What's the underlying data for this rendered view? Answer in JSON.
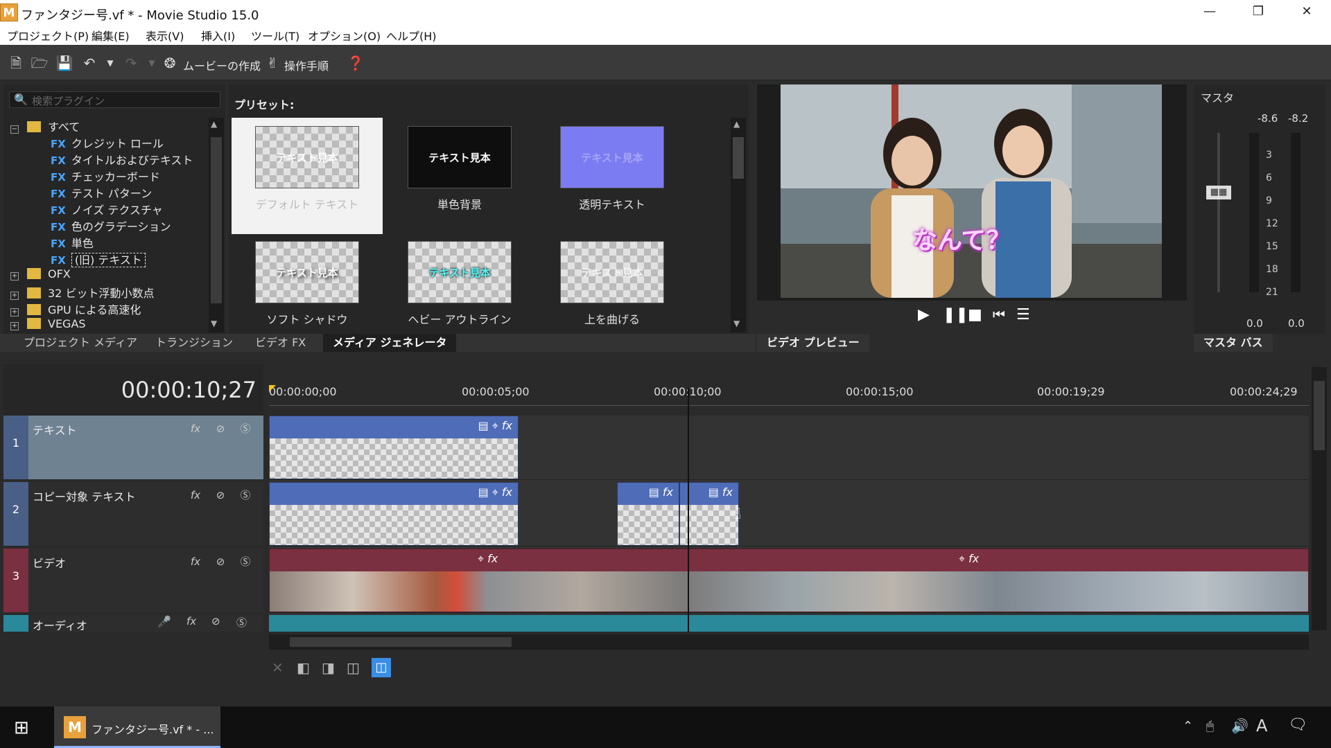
{
  "window": {
    "app_icon": "M",
    "title": "ファンタジー号.vf * - Movie Studio 15.0",
    "controls": [
      "—",
      "❐",
      "✕"
    ]
  },
  "menu": [
    "プロジェクト(P)",
    "編集(E)",
    "表示(V)",
    "挿入(I)",
    "ツール(T)",
    "オプション(O)",
    "ヘルプ(H)"
  ],
  "toolbar": {
    "make_movie": "ムービーの作成",
    "steps": "操作手順"
  },
  "plugins": {
    "search_placeholder": "検索プラグイン",
    "tree": [
      {
        "type": "folder",
        "label": "すべて",
        "expander": "−"
      },
      {
        "type": "fx",
        "label": "クレジット ロール"
      },
      {
        "type": "fx",
        "label": "タイトルおよびテキスト"
      },
      {
        "type": "fx",
        "label": "チェッカーボード"
      },
      {
        "type": "fx",
        "label": "テスト パターン"
      },
      {
        "type": "fx",
        "label": "ノイズ テクスチャ"
      },
      {
        "type": "fx",
        "label": "色のグラデーション"
      },
      {
        "type": "fx",
        "label": "単色"
      },
      {
        "type": "fx",
        "label": "(旧) テキスト",
        "selected": true
      },
      {
        "type": "folder",
        "label": "OFX",
        "expander": "+"
      },
      {
        "type": "folder",
        "label": "32 ビット浮動小数点",
        "expander": "+"
      },
      {
        "type": "folder",
        "label": "GPU による高速化",
        "expander": "+"
      },
      {
        "type": "folder",
        "label": "VEGAS",
        "expander": "+"
      }
    ],
    "fx_tag": "FX"
  },
  "presets": {
    "header": "プリセット:",
    "thumb_text": "テキスト見本",
    "items": [
      {
        "label": "デフォルト テキスト",
        "style": "default"
      },
      {
        "label": "単色背景",
        "style": "solid"
      },
      {
        "label": "透明テキスト",
        "style": "transparent"
      },
      {
        "label": "ソフト シャドウ",
        "style": "shadow"
      },
      {
        "label": "ヘビー アウトライン",
        "style": "outline"
      },
      {
        "label": "上を曲げる",
        "style": "bend"
      }
    ]
  },
  "tabs": [
    "プロジェクト メディア",
    "トランジション",
    "ビデオ FX",
    "メディア ジェネレータ"
  ],
  "preview": {
    "overlay_text": "なんて？",
    "tab": "ビデオ プレビュー"
  },
  "master": {
    "title": "マスタ",
    "peak_left": "-8.6",
    "peak_right": "-8.2",
    "scale": [
      "3",
      "6",
      "9",
      "12",
      "15",
      "18",
      "21"
    ],
    "bottom_left": "0.0",
    "bottom_right": "0.0",
    "tab": "マスタ バス"
  },
  "timeline": {
    "timecode": "00:00:10;27",
    "ruler": [
      "00:00:00;00",
      "00:00:05;00",
      "00:00:10;00",
      "00:00:15;00",
      "00:00:19;29",
      "00:00:24;29"
    ],
    "tracks": [
      {
        "num": "1",
        "name": "テキスト"
      },
      {
        "num": "2",
        "name": "コピー対象 テキスト"
      },
      {
        "num": "3",
        "name": "ビデオ"
      },
      {
        "num": "",
        "name": "オーディオ"
      }
    ]
  },
  "taskbar": {
    "app_label": "ファンタジー号.vf * - ...",
    "ime": "A"
  },
  "colors": {
    "text_event": "#4f6cb8",
    "video_event": "#7a3040",
    "audio_event": "#2a8a9a",
    "accent": "#3a8ee6"
  }
}
